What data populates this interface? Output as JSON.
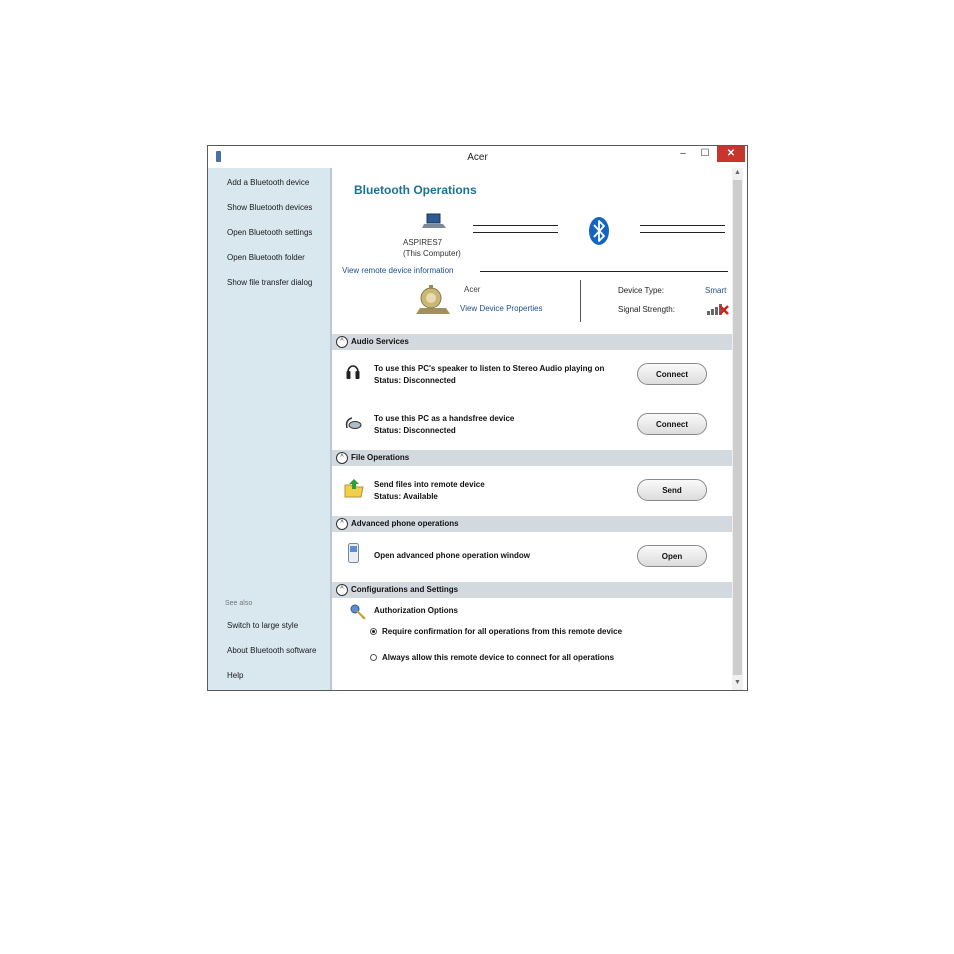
{
  "window": {
    "title": "Acer",
    "minimize": "–",
    "maximize": "☐",
    "close": "✕"
  },
  "sidebar": {
    "items": [
      "Add a Bluetooth device",
      "Show Bluetooth devices",
      "Open Bluetooth settings",
      "Open Bluetooth folder",
      "Show file transfer dialog"
    ],
    "see_also_label": "See also",
    "see_also_items": [
      "Switch to large style",
      "About Bluetooth software",
      "Help"
    ]
  },
  "main": {
    "heading": "Bluetooth Operations",
    "computer": {
      "name": "ASPIRES7",
      "sub": "(This Computer)"
    },
    "view_remote_link": "View remote device information",
    "device": {
      "name": "Acer",
      "properties_link": "View Device Properties",
      "type_label": "Device Type:",
      "type_value": "Smart",
      "signal_label": "Signal Strength:"
    },
    "sections": {
      "audio": {
        "title": "Audio Services",
        "items": [
          {
            "text": "To use this PC's speaker to listen to Stereo Audio playing on",
            "status": "Status:   Disconnected",
            "button": "Connect"
          },
          {
            "text": "To use this PC as a handsfree device",
            "status": "Status:   Disconnected",
            "button": "Connect"
          }
        ]
      },
      "file": {
        "title": "File Operations",
        "items": [
          {
            "text": "Send files into remote device",
            "status": "Status:   Available",
            "button": "Send"
          }
        ]
      },
      "phone": {
        "title": "Advanced phone operations",
        "items": [
          {
            "text": "Open advanced phone operation window",
            "button": "Open"
          }
        ]
      },
      "config": {
        "title": "Configurations and Settings",
        "auth_title": "Authorization Options",
        "options": [
          "Require confirmation for all operations from this remote device",
          "Always allow this remote device to connect for all operations"
        ],
        "selected_index": 0
      }
    }
  },
  "colors": {
    "accent": "#1d7193",
    "sidebar": "#d9e7ef",
    "section": "#d2d9df",
    "close": "#c7352b"
  }
}
